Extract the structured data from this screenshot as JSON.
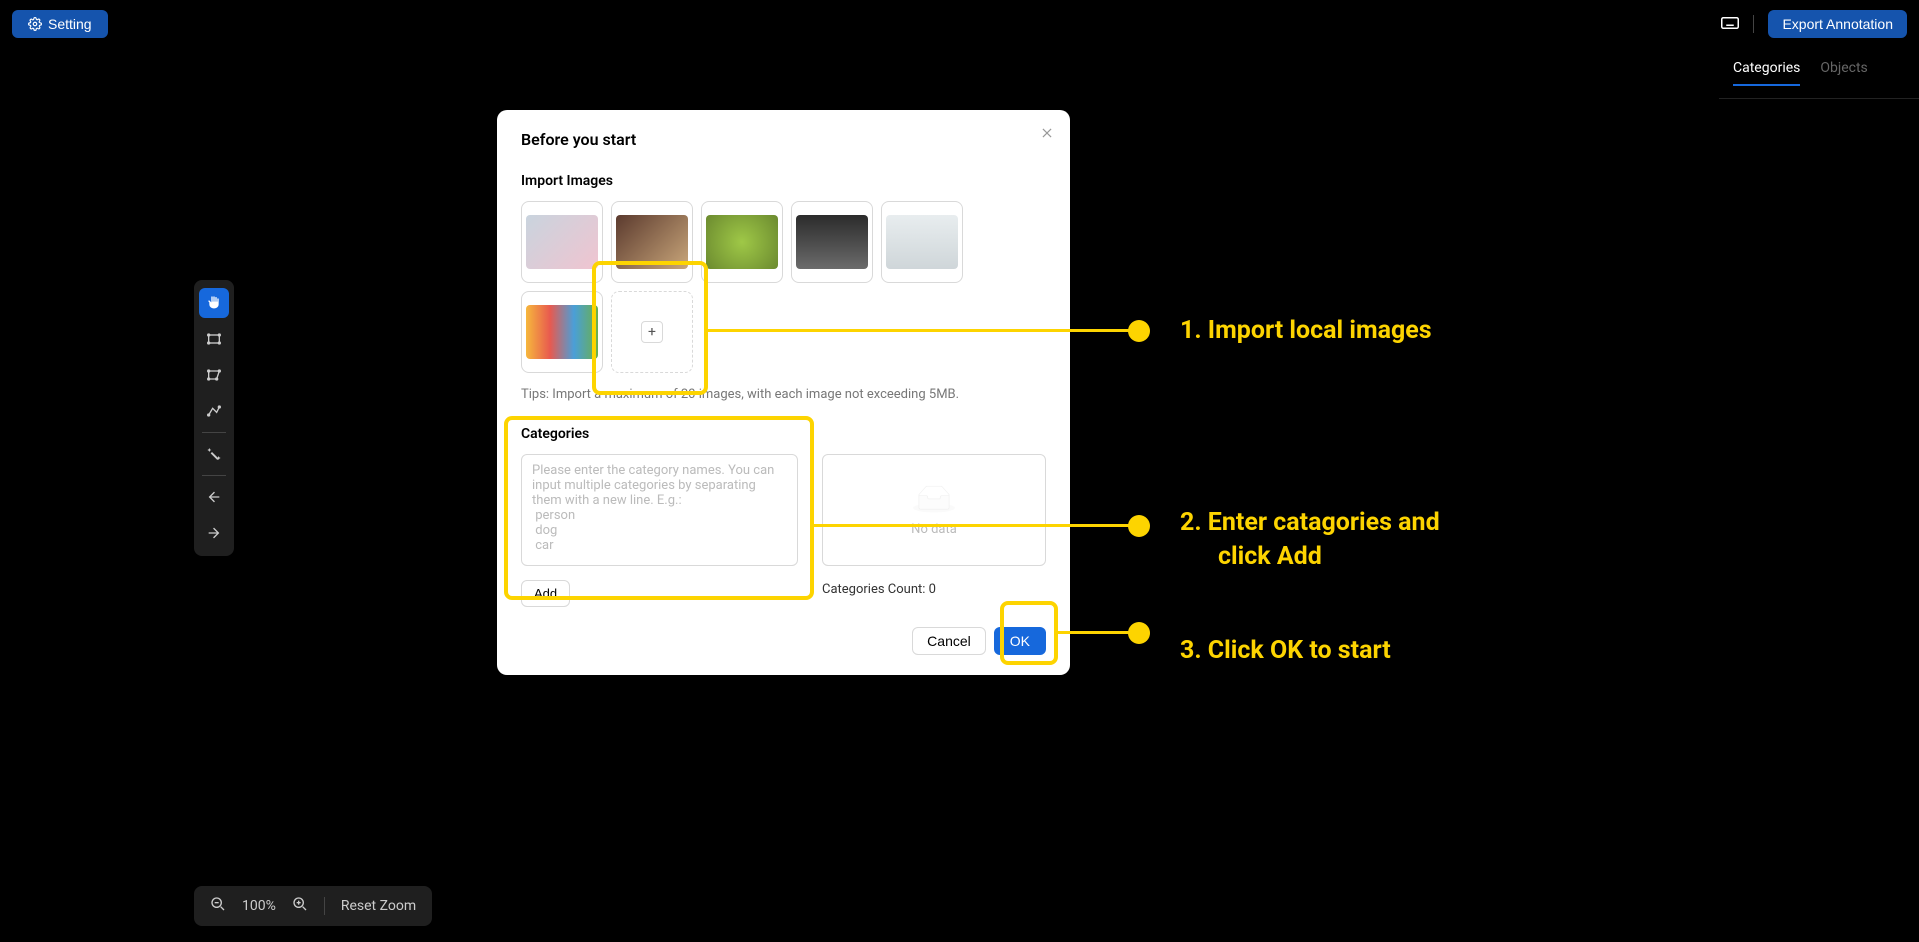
{
  "top": {
    "setting_label": "Setting",
    "export_label": "Export Annotation"
  },
  "tabs": {
    "categories": "Categories",
    "objects": "Objects"
  },
  "zoom": {
    "percent": "100%",
    "reset": "Reset Zoom"
  },
  "modal": {
    "title": "Before you start",
    "import_title": "Import Images",
    "tips": "Tips: Import a maximum of 20 images, with each image not exceeding 5MB.",
    "categories_title": "Categories",
    "categories_placeholder": "Please enter the category names. You can input multiple categories by separating them with a new line. E.g.:\n person\n dog\n car",
    "add_label": "Add",
    "nodata_label": "No data",
    "count_label": "Categories Count: 0",
    "cancel_label": "Cancel",
    "ok_label": "OK"
  },
  "annotations": {
    "step1": "1. Import local images",
    "step2a": "2. Enter catagories and",
    "step2b": "click Add",
    "step3": "3. Click OK to start"
  }
}
